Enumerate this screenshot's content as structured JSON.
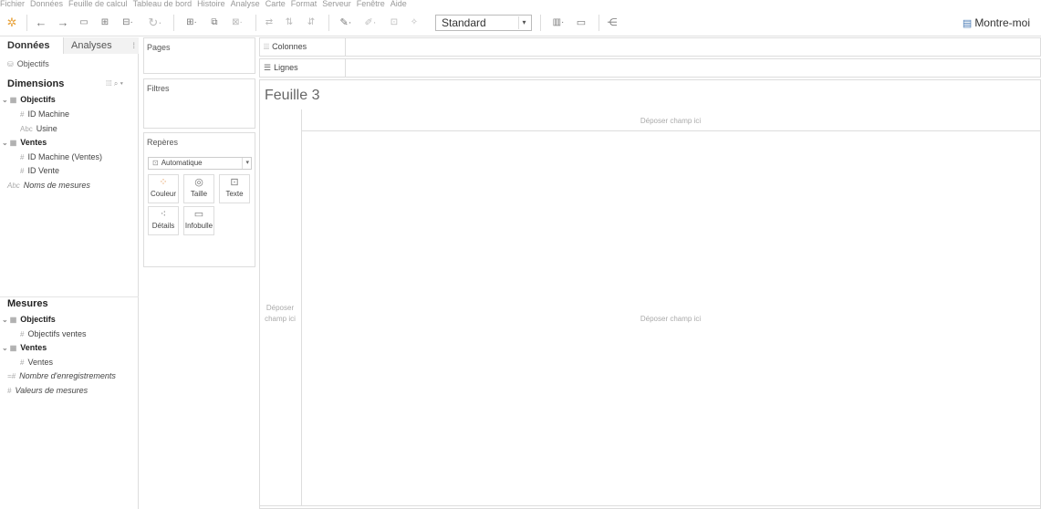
{
  "menubar": [
    "Fichier",
    "Données",
    "Feuille de calcul",
    "Tableau de bord",
    "Histoire",
    "Analyse",
    "Carte",
    "Format",
    "Serveur",
    "Fenêtre",
    "Aide"
  ],
  "toolbar": {
    "view_mode": "Standard",
    "show_me": "Montre-moi"
  },
  "datapane": {
    "tab_data": "Données",
    "tab_analytics": "Analyses",
    "datasource": "Objectifs",
    "dimensions_header": "Dimensions",
    "dimensions": [
      {
        "label": "Objectifs",
        "type": "group"
      },
      {
        "label": "ID Machine",
        "type": "number"
      },
      {
        "label": "Usine",
        "type": "string"
      },
      {
        "label": "Ventes",
        "type": "group"
      },
      {
        "label": "ID Machine (Ventes)",
        "type": "number"
      },
      {
        "label": "ID Vente",
        "type": "number"
      },
      {
        "label": "Noms de mesures",
        "type": "string-italic"
      }
    ],
    "measures_header": "Mesures",
    "measures": [
      {
        "label": "Objectifs",
        "type": "group"
      },
      {
        "label": "Objectifs ventes",
        "type": "number"
      },
      {
        "label": "Ventes",
        "type": "group"
      },
      {
        "label": "Ventes",
        "type": "number"
      },
      {
        "label": "Nombre d'enregistrements",
        "type": "number-italic"
      },
      {
        "label": "Valeurs de mesures",
        "type": "number-italic"
      }
    ]
  },
  "cards": {
    "pages": "Pages",
    "filters": "Filtres",
    "marks": "Repères",
    "mark_type": "Automatique",
    "buttons": [
      "Couleur",
      "Taille",
      "Texte",
      "Détails",
      "Infobulle"
    ]
  },
  "shelves": {
    "columns": "Colonnes",
    "rows": "Lignes"
  },
  "view": {
    "sheet_title": "Feuille 3",
    "drop_top": "Déposer champ ici",
    "drop_left": "Déposer champ ici",
    "drop_center": "Déposer champ ici"
  }
}
